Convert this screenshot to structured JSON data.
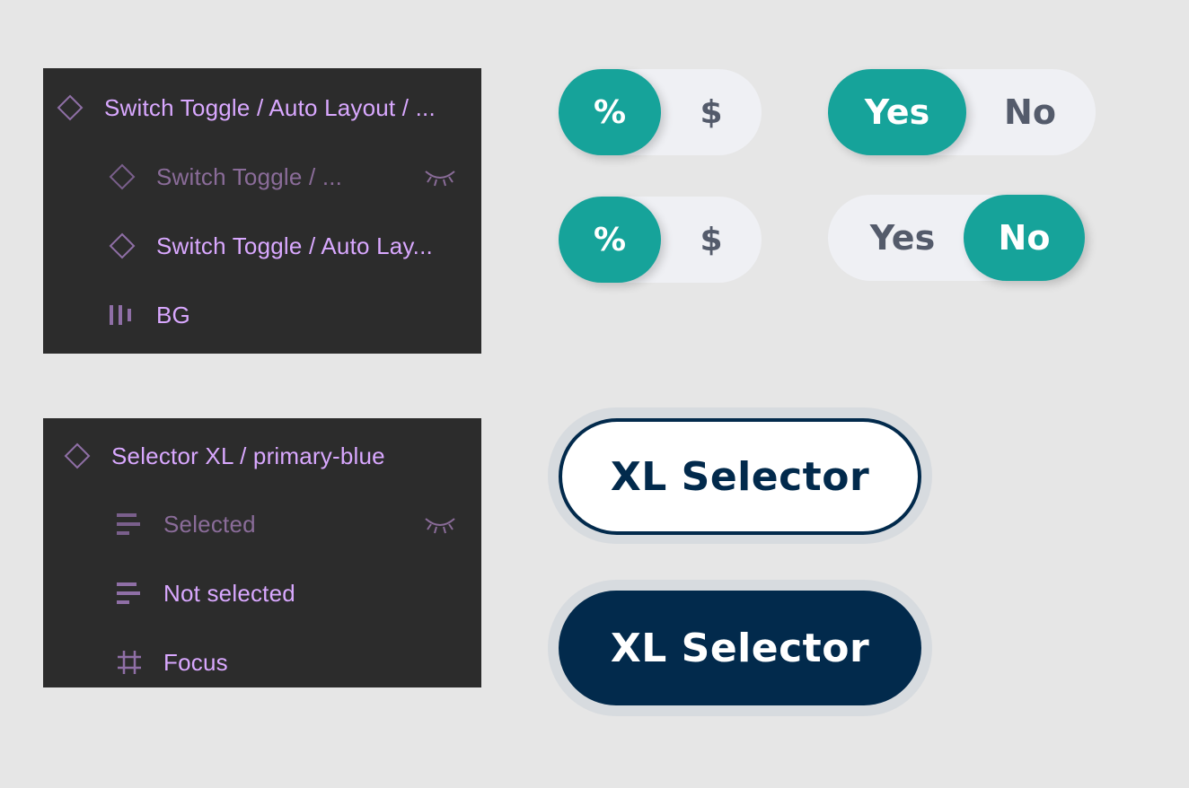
{
  "layers_panel_1": {
    "items": [
      {
        "label": "Switch Toggle / Auto Layout / ...",
        "icon": "component-diamond-icon"
      },
      {
        "label": "Switch Toggle / ...",
        "icon": "component-diamond-icon",
        "hidden": true,
        "hidden_icon": "eye-closed-icon"
      },
      {
        "label": "Switch Toggle / Auto Lay...",
        "icon": "component-diamond-icon"
      },
      {
        "label": "BG",
        "icon": "auto-layout-bars-icon"
      }
    ]
  },
  "layers_panel_2": {
    "items": [
      {
        "label": "Selector XL / primary-blue",
        "icon": "component-diamond-icon"
      },
      {
        "label": "Selected",
        "icon": "text-align-left-icon",
        "hidden": true,
        "hidden_icon": "eye-closed-icon"
      },
      {
        "label": "Not selected",
        "icon": "text-align-left-icon"
      },
      {
        "label": "Focus",
        "icon": "frame-hash-icon"
      }
    ]
  },
  "toggles": [
    {
      "options": [
        "%",
        "$"
      ],
      "selected": "%"
    },
    {
      "options": [
        "Yes",
        "No"
      ],
      "selected": "Yes"
    },
    {
      "options": [
        "%",
        "$"
      ],
      "selected": "%"
    },
    {
      "options": [
        "Yes",
        "No"
      ],
      "selected": "No"
    }
  ],
  "selectors": [
    {
      "label": "XL Selector",
      "state": "not selected"
    },
    {
      "label": "XL Selector",
      "state": "selected"
    }
  ],
  "colors": {
    "canvas_bg": "#e6e6e6",
    "panel_bg": "#2c2c2c",
    "layer_text": "#d9a8ff",
    "layer_text_hidden": "#8a6c99",
    "toggle_active": "#16a39a",
    "toggle_track": "#eff0f4",
    "toggle_inactive_text": "#545b6b",
    "selector_navy": "#022a4c",
    "selector_focus_ring": "#d7dbdf"
  }
}
